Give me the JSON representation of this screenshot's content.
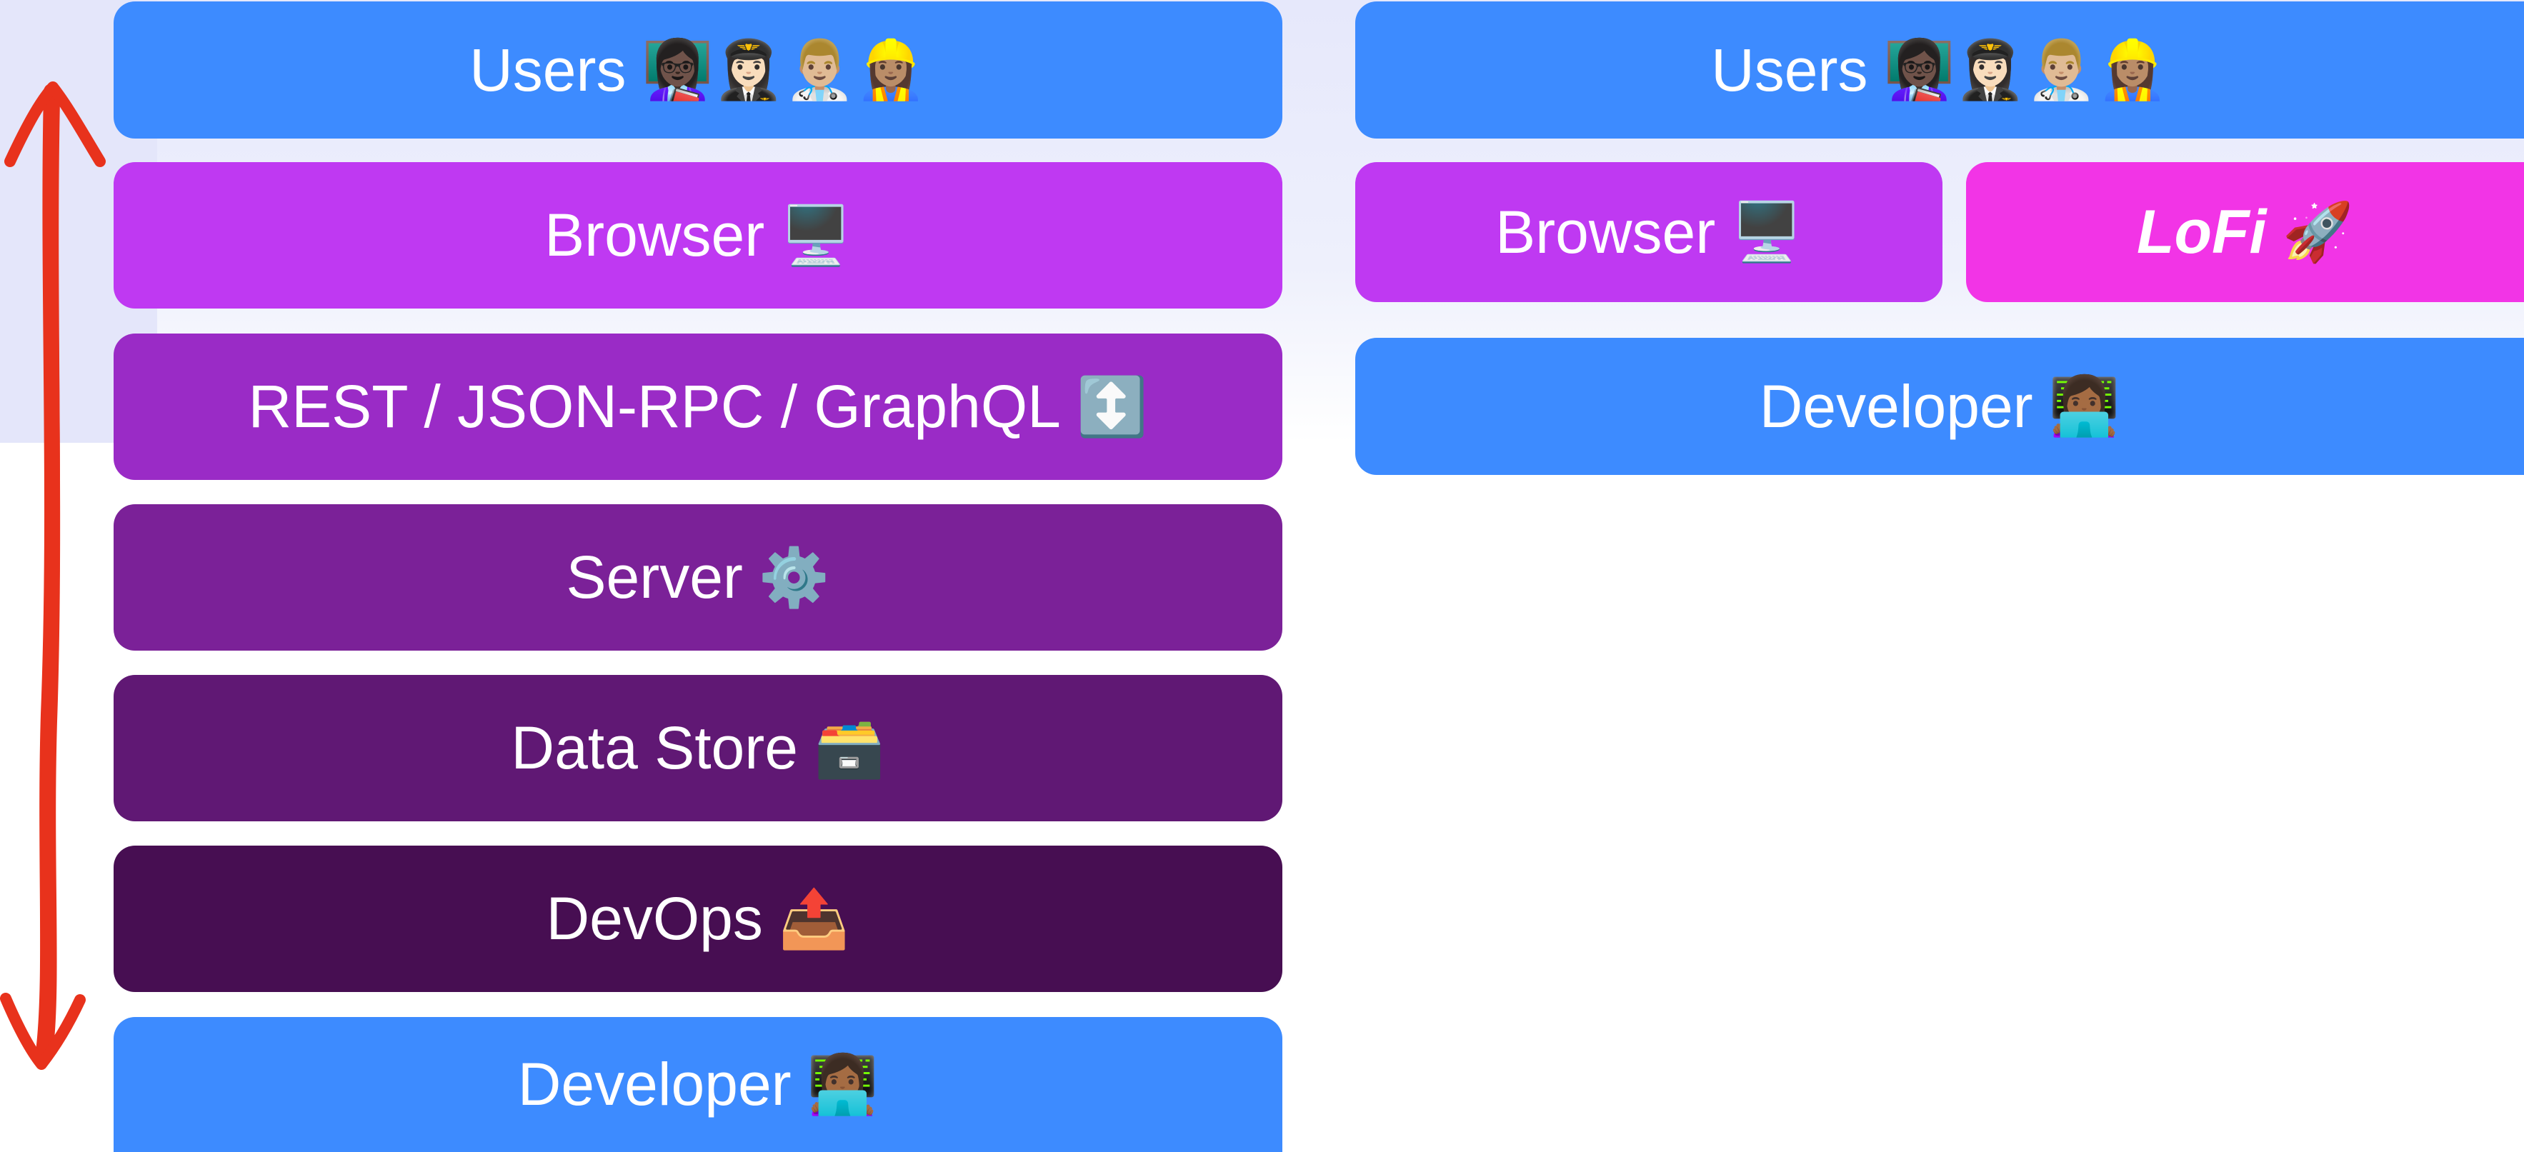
{
  "left_stack": [
    {
      "label": "Users",
      "icon": "👩🏿‍🏫👩🏻‍✈️👨🏼‍⚕️👷🏽‍♀️",
      "color": "#3d8bff"
    },
    {
      "label": "Browser",
      "icon": "🖥️",
      "color": "#bf39f2"
    },
    {
      "label": "REST / JSON-RPC / GraphQL",
      "icon": "↕️",
      "color": "#9a2bc6"
    },
    {
      "label": "Server",
      "icon": "⚙️",
      "color": "#7b2198"
    },
    {
      "label": "Data Store",
      "icon": "🗃️",
      "color": "#601874"
    },
    {
      "label": "DevOps",
      "icon": "📤",
      "color": "#470e52"
    },
    {
      "label": "Developer",
      "icon": "👩🏾‍💻",
      "color": "#3d8bff"
    }
  ],
  "right_stack": {
    "users": {
      "label": "Users",
      "icon": "👩🏿‍🏫👩🏻‍✈️👨🏼‍⚕️👷🏽‍♀️",
      "color": "#3d8bff"
    },
    "browser": {
      "label": "Browser",
      "icon": "🖥️",
      "color": "#bf39f2"
    },
    "lofi": {
      "label": "LoFi",
      "icon": "🚀",
      "color": "#f234e6"
    },
    "developer": {
      "label": "Developer",
      "icon": "👩🏾‍💻",
      "color": "#3d8bff"
    }
  },
  "arrow_color": "#e8321c"
}
